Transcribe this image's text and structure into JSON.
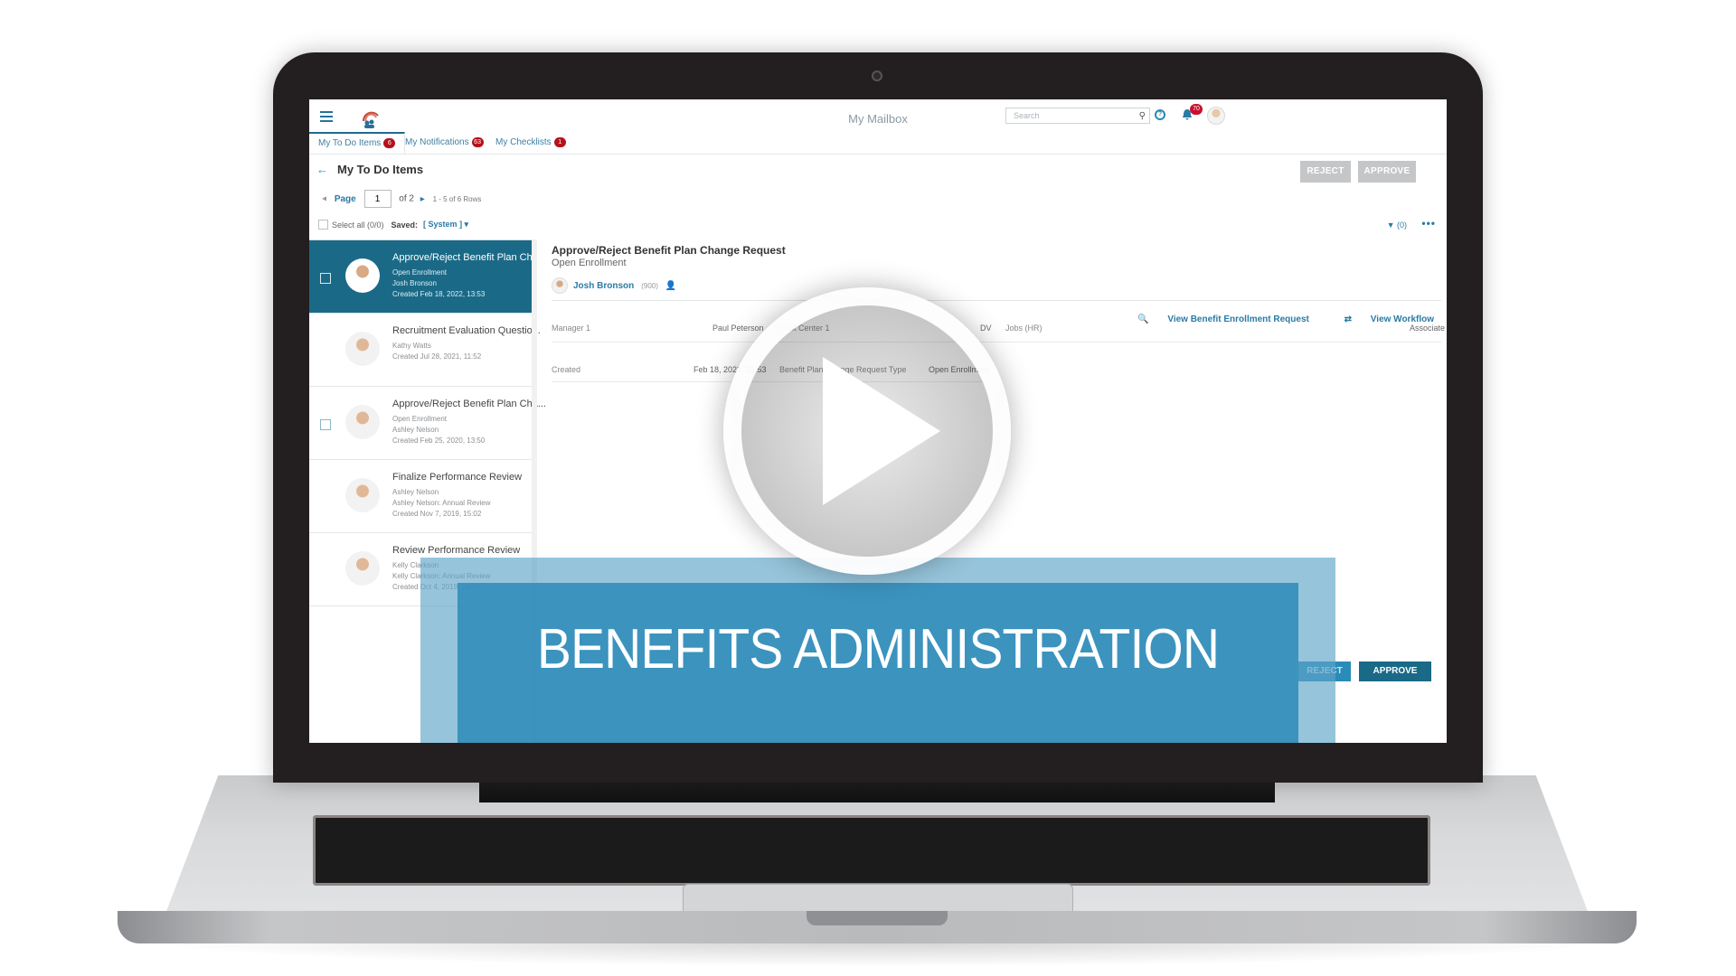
{
  "video": {
    "banner_title": "BENEFITS ADMINISTRATION",
    "play_icon": "play-icon"
  },
  "app": {
    "title": "My Mailbox",
    "search_placeholder": "Search",
    "notifications_count": "70",
    "icons": [
      "menu-icon",
      "logo-icon",
      "search-icon",
      "help-icon",
      "bell-icon",
      "avatar"
    ]
  },
  "tabs": [
    {
      "label": "My To Do Items",
      "badge": "6",
      "active": true
    },
    {
      "label": "My Notifications",
      "badge": "63",
      "active": false
    },
    {
      "label": "My Checklists",
      "badge": "1",
      "active": false
    }
  ],
  "page": {
    "title": "My To Do Items",
    "reject_label": "REJECT",
    "approve_label": "APPROVE"
  },
  "pager": {
    "page_label": "Page",
    "current_page": "1",
    "of_label": "of 2",
    "rows_label": "1 - 5 of 6 Rows"
  },
  "selection": {
    "select_all_label": "Select all (0/0)",
    "saved_label": "Saved:",
    "saved_value": "[ System ] ▾",
    "filter_label": "(0)",
    "more_label": "•••"
  },
  "items": [
    {
      "title": "Approve/Reject Benefit Plan Cha...",
      "lines": [
        "Open Enrollment",
        "Josh Bronson",
        "Created Feb 18, 2022, 13:53"
      ],
      "selected": true,
      "has_checkbox": true
    },
    {
      "title": "Recruitment Evaluation Questio...",
      "lines": [
        "Kathy Watts",
        "Created Jul 28, 2021, 11:52"
      ],
      "selected": false,
      "has_checkbox": false
    },
    {
      "title": "Approve/Reject Benefit Plan Cha...",
      "lines": [
        "Open Enrollment",
        "Ashley Nelson",
        "Created Feb 25, 2020, 13:50"
      ],
      "selected": false,
      "has_checkbox": true
    },
    {
      "title": "Finalize Performance Review",
      "lines": [
        "Ashley Nelson",
        "Ashley Nelson: Annual Review",
        "Created Nov 7, 2019, 15:02"
      ],
      "selected": false,
      "has_checkbox": false
    },
    {
      "title": "Review Performance Review",
      "lines": [
        "Kelly Clarkson",
        "Kelly Clarkson: Annual Review",
        "Created Oct 4, 2019, 14:21"
      ],
      "selected": false,
      "has_checkbox": false
    }
  ],
  "detail": {
    "title": "Approve/Reject Benefit Plan Change Request",
    "subtitle": "Open Enrollment",
    "person_name": "Josh Bronson",
    "person_code": "(900)",
    "view_request_label": "View Benefit Enrollment Request",
    "view_workflow_label": "View Workflow",
    "rows": [
      {
        "label1": "Manager 1",
        "value1": "Paul Peterson",
        "label2": "Cost Center 1",
        "value2": "DV",
        "label3": "Jobs (HR)",
        "value3": "Associate"
      },
      {
        "label1": "Created",
        "value1": "Feb 18, 2022, 13:53",
        "label2": "Benefit Plan Change Request Type",
        "value2": "Open Enrollment",
        "label3": "",
        "value3": ""
      }
    ],
    "reject_label": "REJECT",
    "approve_label": "APPROVE"
  },
  "colors": {
    "primary": "#1a6a87",
    "accent": "#2a7ba4",
    "badge": "#b5121b",
    "banner": "#2f8cba"
  }
}
